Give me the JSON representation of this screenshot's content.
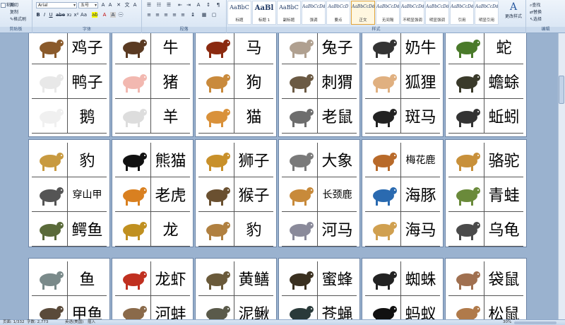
{
  "ribbon": {
    "clipboard": {
      "paste": "粘贴",
      "cut": "剪切",
      "copy": "复制",
      "format_painter": "格式刷",
      "label": "剪贴板"
    },
    "font": {
      "family": "Arial",
      "size": "五号",
      "label": "字体"
    },
    "paragraph": {
      "label": "段落"
    },
    "styles": {
      "label": "样式",
      "items": [
        {
          "preview": "AaBbC",
          "name": "标题"
        },
        {
          "preview": "AaBl",
          "name": "标题 1"
        },
        {
          "preview": "AaBbC",
          "name": "副标题"
        },
        {
          "preview": "AaBbCcDd",
          "name": "强调"
        },
        {
          "preview": "AaBbCcD",
          "name": "要点"
        },
        {
          "preview": "AaBbCcDd",
          "name": "正文"
        },
        {
          "preview": "AaBbCcDd",
          "name": "无间隔"
        },
        {
          "preview": "AaBbCcDd",
          "name": "不明显强调"
        },
        {
          "preview": "AaBbCcDd",
          "name": "明显强调"
        },
        {
          "preview": "AaBbCcDd",
          "name": "引用"
        },
        {
          "preview": "AaBbCcDd",
          "name": "明显引用"
        }
      ],
      "change": "更改样式"
    },
    "editing": {
      "find": "查找",
      "replace": "替换",
      "select": "选择",
      "label": "编辑"
    }
  },
  "pages": [
    {
      "cells": [
        {
          "word": "鸡子",
          "animal": "chicken"
        },
        {
          "word": "鸭子",
          "animal": "duck"
        },
        {
          "word": "鹅",
          "animal": "goose"
        },
        {
          "word": "牛",
          "animal": "cow"
        },
        {
          "word": "猪",
          "animal": "pig"
        },
        {
          "word": "羊",
          "animal": "goat"
        },
        {
          "word": "马",
          "animal": "horse"
        },
        {
          "word": "狗",
          "animal": "dog"
        },
        {
          "word": "猫",
          "animal": "cat"
        },
        {
          "word": "兔子",
          "animal": "rabbit"
        },
        {
          "word": "刺猬",
          "animal": "hedgehog"
        },
        {
          "word": "老鼠",
          "animal": "rat"
        },
        {
          "word": "奶牛",
          "animal": "dairy-cow"
        },
        {
          "word": "狐狸",
          "animal": "fox"
        },
        {
          "word": "斑马",
          "animal": "zebra"
        },
        {
          "word": "蛇",
          "animal": "snake"
        },
        {
          "word": "蟾蜍",
          "animal": "toad"
        },
        {
          "word": "蚯蚓",
          "animal": "earthworm"
        }
      ]
    },
    {
      "cells": [
        {
          "word": "豹",
          "animal": "leopard"
        },
        {
          "word": "穿山甲",
          "animal": "pangolin"
        },
        {
          "word": "鳄鱼",
          "animal": "crocodile"
        },
        {
          "word": "熊猫",
          "animal": "panda"
        },
        {
          "word": "老虎",
          "animal": "tiger"
        },
        {
          "word": "龙",
          "animal": "dragon"
        },
        {
          "word": "狮子",
          "animal": "lion"
        },
        {
          "word": "猴子",
          "animal": "monkey"
        },
        {
          "word": "豹",
          "animal": "cheetah"
        },
        {
          "word": "大象",
          "animal": "elephant"
        },
        {
          "word": "长颈鹿",
          "animal": "giraffe"
        },
        {
          "word": "河马",
          "animal": "hippo"
        },
        {
          "word": "梅花鹿",
          "animal": "deer"
        },
        {
          "word": "海豚",
          "animal": "dolphin"
        },
        {
          "word": "海马",
          "animal": "seahorse"
        },
        {
          "word": "骆驼",
          "animal": "camel"
        },
        {
          "word": "青蛙",
          "animal": "frog"
        },
        {
          "word": "乌龟",
          "animal": "tortoise"
        }
      ]
    },
    {
      "cells": [
        {
          "word": "鱼",
          "animal": "fish"
        },
        {
          "word": "甲鱼",
          "animal": "softshell-turtle"
        },
        {
          "word": "龙虾",
          "animal": "lobster"
        },
        {
          "word": "河蚌",
          "animal": "mussel"
        },
        {
          "word": "黄鳝",
          "animal": "eel"
        },
        {
          "word": "泥鳅",
          "animal": "loach"
        },
        {
          "word": "蜜蜂",
          "animal": "bee"
        },
        {
          "word": "苍蝇",
          "animal": "fly"
        },
        {
          "word": "蜘蛛",
          "animal": "spider"
        },
        {
          "word": "蚂蚁",
          "animal": "ant"
        },
        {
          "word": "袋鼠",
          "animal": "kangaroo"
        },
        {
          "word": "松鼠",
          "animal": "squirrel"
        }
      ]
    }
  ],
  "status": {
    "page": "页面: 1/332",
    "words": "字数: 2,773",
    "language": "英语(美国)",
    "mode": "插入",
    "zoom": "30%"
  },
  "colors": {
    "workspace": "#9ab2cf",
    "ribbon": "#dbe6f4",
    "accent": "#e3a53a"
  }
}
